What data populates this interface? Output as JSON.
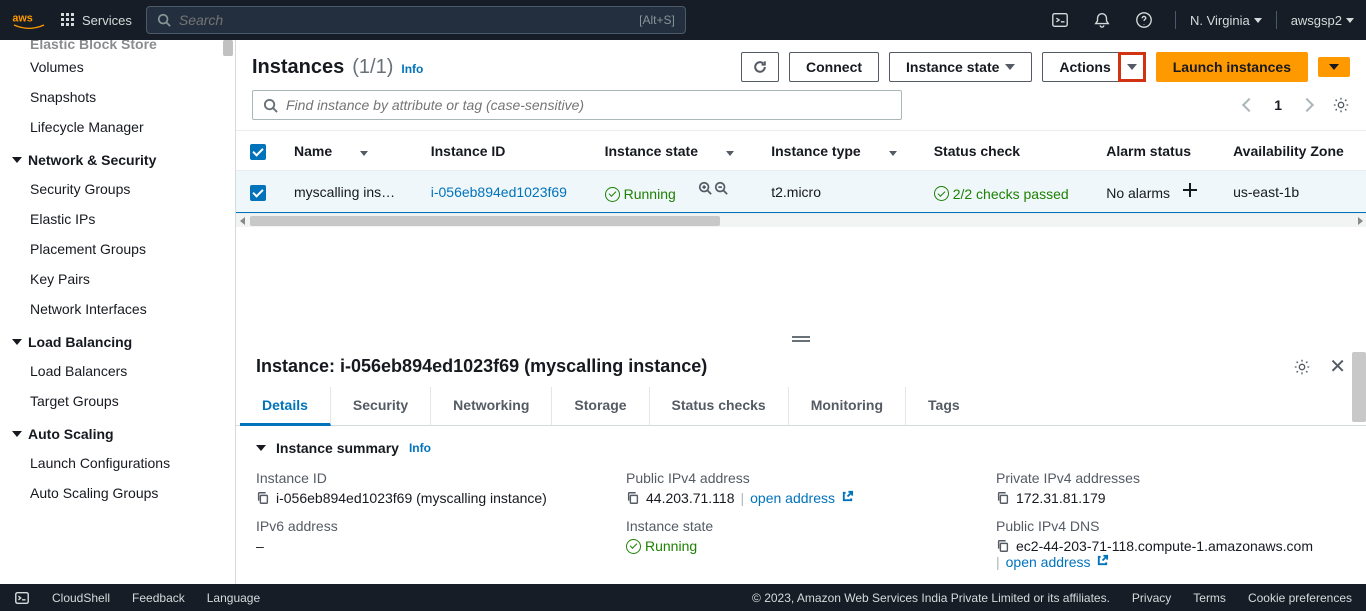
{
  "topnav": {
    "services": "Services",
    "search_placeholder": "Search",
    "search_kbd": "[Alt+S]",
    "region": "N. Virginia",
    "account": "awsgsp2"
  },
  "sidebar": {
    "truncated_group": "Elastic Block Store",
    "ebs_items": [
      "Volumes",
      "Snapshots",
      "Lifecycle Manager"
    ],
    "groups": [
      {
        "title": "Network & Security",
        "items": [
          "Security Groups",
          "Elastic IPs",
          "Placement Groups",
          "Key Pairs",
          "Network Interfaces"
        ]
      },
      {
        "title": "Load Balancing",
        "items": [
          "Load Balancers",
          "Target Groups"
        ]
      },
      {
        "title": "Auto Scaling",
        "items": [
          "Launch Configurations",
          "Auto Scaling Groups"
        ]
      }
    ]
  },
  "page": {
    "title": "Instances",
    "count": "(1/1)",
    "info": "Info",
    "connect": "Connect",
    "instance_state": "Instance state",
    "actions": "Actions",
    "launch": "Launch instances",
    "filter_placeholder": "Find instance by attribute or tag (case-sensitive)",
    "page_num": "1"
  },
  "table": {
    "headers": {
      "name": "Name",
      "id": "Instance ID",
      "state": "Instance state",
      "type": "Instance type",
      "status": "Status check",
      "alarm": "Alarm status",
      "az": "Availability Zone"
    },
    "row": {
      "name": "myscalling ins…",
      "id": "i-056eb894ed1023f69",
      "state": "Running",
      "type": "t2.micro",
      "status": "2/2 checks passed",
      "alarm": "No alarms",
      "az": "us-east-1b"
    }
  },
  "details": {
    "title": "Instance: i-056eb894ed1023f69 (myscalling instance)",
    "tabs": [
      "Details",
      "Security",
      "Networking",
      "Storage",
      "Status checks",
      "Monitoring",
      "Tags"
    ],
    "summary_title": "Instance summary",
    "summary_info": "Info",
    "fields": {
      "instance_id": {
        "label": "Instance ID",
        "value": "i-056eb894ed1023f69 (myscalling instance)"
      },
      "public_ipv4": {
        "label": "Public IPv4 address",
        "value": "44.203.71.118",
        "open": "open address"
      },
      "private_ipv4": {
        "label": "Private IPv4 addresses",
        "value": "172.31.81.179"
      },
      "ipv6": {
        "label": "IPv6 address",
        "value": "–"
      },
      "instance_state": {
        "label": "Instance state",
        "value": "Running"
      },
      "public_dns": {
        "label": "Public IPv4 DNS",
        "value": "ec2-44-203-71-118.compute-1.amazonaws.com",
        "open": "open address"
      }
    }
  },
  "footer": {
    "cloudshell": "CloudShell",
    "feedback": "Feedback",
    "language": "Language",
    "copyright": "© 2023, Amazon Web Services India Private Limited or its affiliates.",
    "privacy": "Privacy",
    "terms": "Terms",
    "cookie": "Cookie preferences"
  }
}
